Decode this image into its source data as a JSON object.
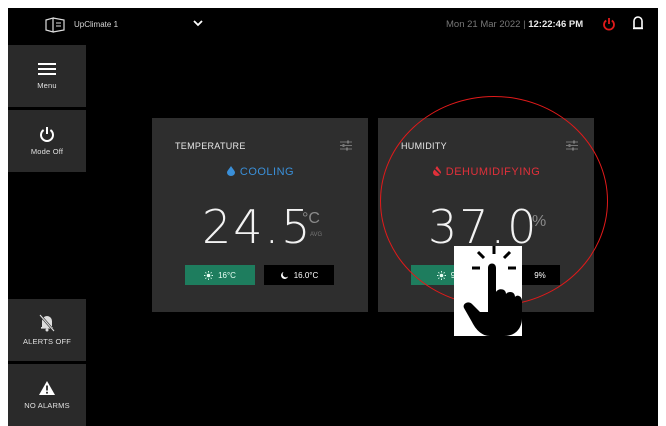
{
  "header": {
    "unit_name": "UpClimate 1",
    "date": "Mon 21 Mar 2022 | ",
    "time": "12:22:46 PM",
    "accent_color": "#e01a1a"
  },
  "sidebar": {
    "menu_label": "Menu",
    "mode_label": "Mode Off",
    "alerts_label": "ALERTS OFF",
    "alarms_label": "NO ALARMS"
  },
  "temperature": {
    "title": "TEMPERATURE",
    "status": "COOLING",
    "status_color": "#3a8fd8",
    "value": "24.5",
    "unit": "°C",
    "avg_label": "AVG",
    "heat_setpoint": "16°C",
    "cool_setpoint": "16.0°C"
  },
  "humidity": {
    "title": "HUMIDITY",
    "status": "DEHUMIDIFYING",
    "status_color": "#e0303a",
    "value": "37.0",
    "unit": "%",
    "heat_setpoint": "9",
    "cool_setpoint": "9%"
  },
  "setpoint_colors": {
    "heat_bg": "#1e7d5e",
    "cool_bg": "#000000"
  }
}
